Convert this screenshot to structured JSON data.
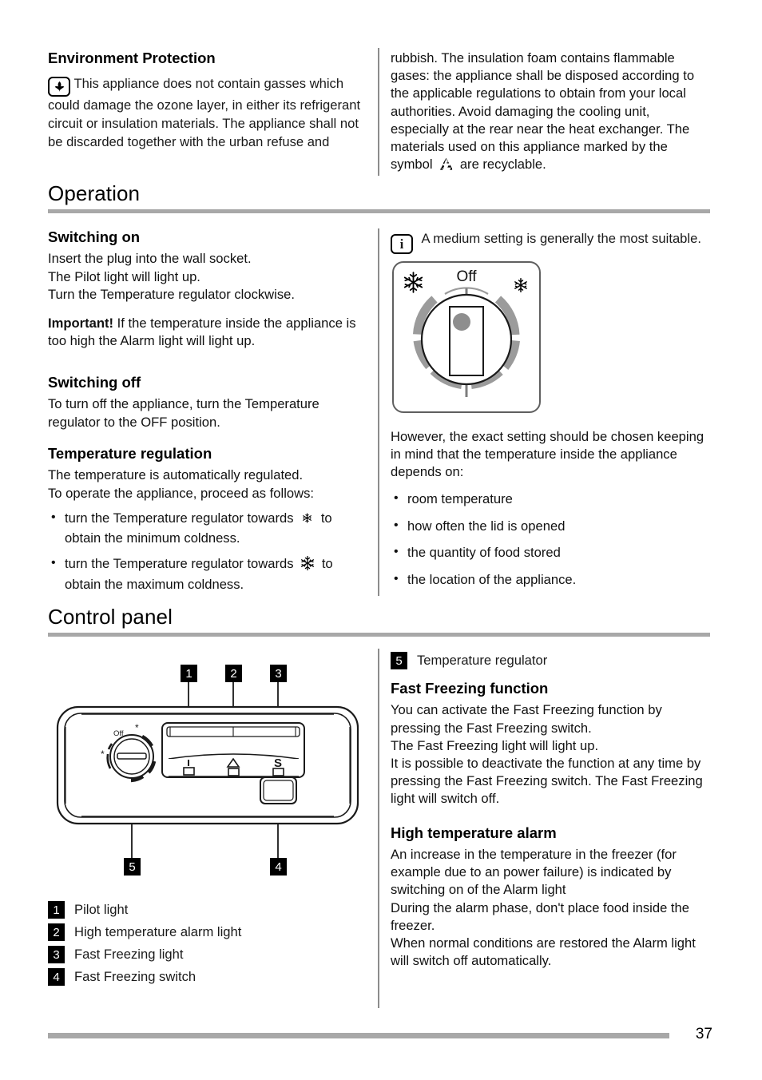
{
  "page": {
    "number": "37"
  },
  "environment": {
    "heading": "Environment Protection",
    "icon": "plant-leaf-icon",
    "note": "This appliance does not contain gasses which could damage the ozone layer, in either its refrigerant circuit or insulation materials. The appliance shall not be discarded together with the urban refuse and",
    "continuation": "rubbish. The insulation foam contains flammable gases: the appliance shall be disposed according to the applicable regulations to obtain from your local authorities. Avoid damaging the cooling unit, especially at the rear near the heat exchanger. The materials used on this appliance marked by the symbol",
    "continuation_tail": "are recyclable.",
    "recycle_icon": "recycle-icon"
  },
  "operation": {
    "heading": "Operation",
    "switching_on": {
      "heading": "Switching on",
      "lines": [
        "Insert the plug into the wall socket.",
        "The Pilot light will light up.",
        "Turn the Temperature regulator clockwise."
      ],
      "important_label": "Important!",
      "important_text": " If the temperature inside the appliance is too high the Alarm light will light up."
    },
    "switching_off": {
      "heading": "Switching off",
      "text": "To turn off the appliance, turn the Temperature regulator to the OFF position."
    },
    "temperature_regulation": {
      "heading": "Temperature regulation",
      "lines": [
        "The temperature is automatically regulated.",
        "To operate the appliance, proceed as follows:"
      ],
      "bullets": [
        {
          "pre": "turn the Temperature regulator towards",
          "icon": "small-snowflake-icon",
          "post": "to obtain the minimum coldness."
        },
        {
          "pre": "turn the Temperature regulator towards",
          "icon": "large-snowflake-icon",
          "post": "to obtain the maximum coldness."
        }
      ]
    },
    "info_note": {
      "icon": "info-icon",
      "text": "A medium setting is generally the most suitable."
    },
    "dial": {
      "off_label": "Off",
      "left_icon": "large-snowflake-icon",
      "right_icon": "small-snowflake-icon",
      "knob_indicator": "knob-pointer-dot"
    },
    "depends": {
      "intro": "However, the exact setting should be chosen keeping in mind that the temperature inside the appliance depends on:",
      "bullets": [
        "room temperature",
        "how often the lid is opened",
        "the quantity of food stored",
        "the location of the appliance."
      ]
    }
  },
  "control_panel": {
    "heading": "Control panel",
    "callouts_top": [
      "1",
      "2",
      "3"
    ],
    "callouts_bottom": [
      "5",
      "4"
    ],
    "diagram": {
      "knob_off_label": "Off",
      "knob_min_icon": "small-snowflake-icon",
      "knob_max_icon": "small-snowflake-icon",
      "indicators": [
        "pilot-bar-icon",
        "alarm-triangle-icon",
        "fast-freeze-s-icon"
      ]
    },
    "legend": [
      {
        "num": "1",
        "label": "Pilot light"
      },
      {
        "num": "2",
        "label": "High temperature alarm light"
      },
      {
        "num": "3",
        "label": "Fast Freezing light"
      },
      {
        "num": "4",
        "label": "Fast Freezing switch"
      }
    ],
    "legend_right": {
      "num": "5",
      "label": "Temperature regulator"
    },
    "fast_freezing": {
      "heading": "Fast Freezing function",
      "lines": [
        "You can activate the Fast Freezing function by pressing the Fast Freezing switch.",
        "The Fast Freezing light will light up.",
        "It is possible to deactivate the function at any time by pressing the Fast Freezing switch. The Fast Freezing light will switch off."
      ]
    },
    "high_temp_alarm": {
      "heading": "High temperature alarm",
      "lines": [
        "An increase in the temperature in the freezer (for example due to an power failure) is indicated by switching on of the Alarm light",
        "During the alarm phase, don't place food inside the freezer.",
        "When normal conditions are restored the Alarm light will switch off automatically."
      ]
    }
  },
  "colors": {
    "rule": "#a8a8a8",
    "divider": "#8c8c8c",
    "arc": "#9b9b9b",
    "text": "#111111"
  }
}
